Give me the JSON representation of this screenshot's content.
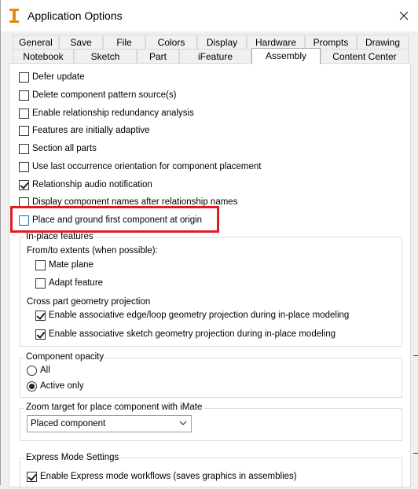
{
  "window": {
    "title": "Application Options",
    "close_symbol": "✕"
  },
  "tabs": {
    "row1": [
      "General",
      "Save",
      "File",
      "Colors",
      "Display",
      "Hardware",
      "Prompts",
      "Drawing"
    ],
    "row2": [
      "Notebook",
      "Sketch",
      "Part",
      "iFeature",
      "Assembly",
      "Content Center"
    ],
    "active": "Assembly"
  },
  "options": [
    {
      "label": "Defer update",
      "checked": false
    },
    {
      "label": "Delete component pattern source(s)",
      "checked": false
    },
    {
      "label": "Enable relationship redundancy analysis",
      "checked": false
    },
    {
      "label": "Features are initially adaptive",
      "checked": false
    },
    {
      "label": "Section all parts",
      "checked": false
    },
    {
      "label": "Use last occurrence orientation for component placement",
      "checked": false
    },
    {
      "label": "Relationship audio notification",
      "checked": true
    },
    {
      "label": "Display component names after relationship names",
      "checked": false
    },
    {
      "label": "Place and ground first component at origin",
      "checked": false
    }
  ],
  "inplace": {
    "group_label": "In-place features",
    "extents_label": "From/to extents (when possible):",
    "mate_plane": {
      "label": "Mate plane",
      "checked": false
    },
    "adapt_feature": {
      "label": "Adapt feature",
      "checked": false
    },
    "projection_label": "Cross part geometry projection",
    "edge_loop": {
      "label": "Enable associative edge/loop geometry projection during in-place modeling",
      "checked": true
    },
    "sketch_geom": {
      "label": "Enable associative sketch geometry projection during in-place modeling",
      "checked": true
    }
  },
  "opacity": {
    "group_label": "Component opacity",
    "all_label": "All",
    "active_only_label": "Active only",
    "selected": "Active only"
  },
  "zoom": {
    "group_label": "Zoom target for place component with iMate",
    "selected_value": "Placed component"
  },
  "express": {
    "group_label": "Express Mode Settings",
    "enable": {
      "label": "Enable Express mode workflows (saves graphics in assemblies)",
      "checked": true
    }
  },
  "colors": {
    "highlight": "#e01b24",
    "app_icon": "#e8871e"
  }
}
